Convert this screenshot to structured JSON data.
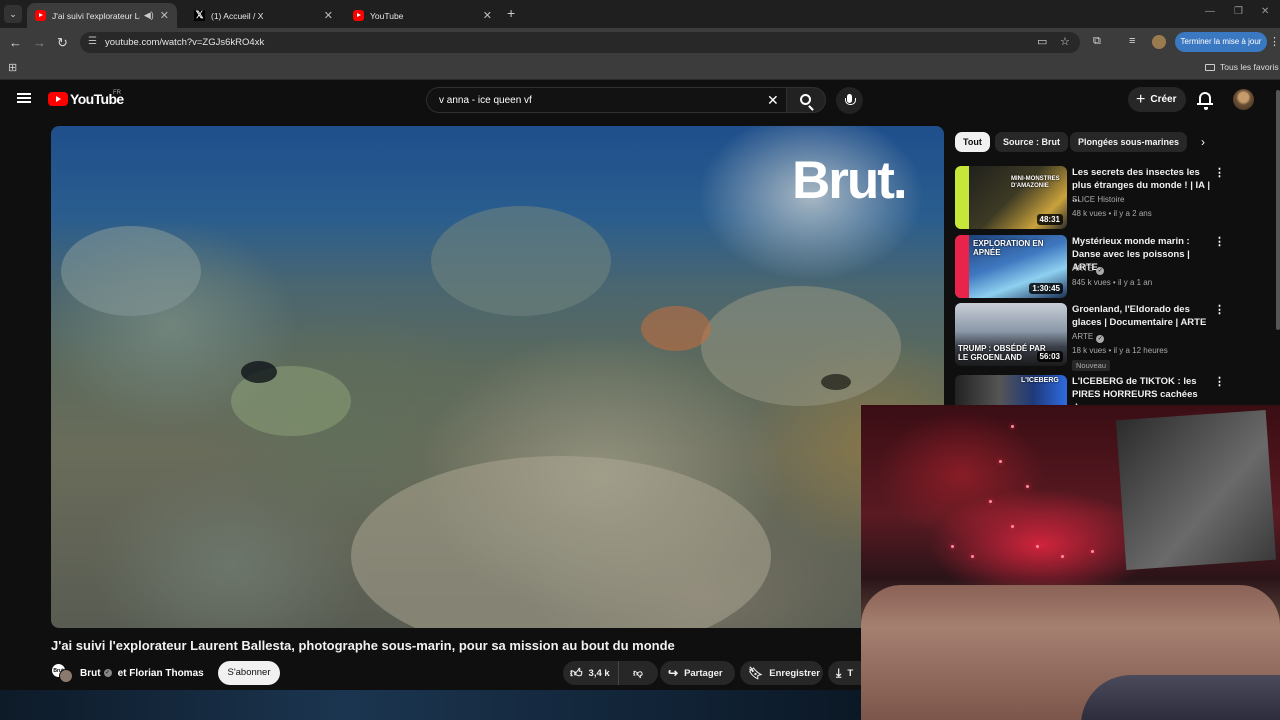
{
  "browser": {
    "tabs": [
      {
        "title": "J'ai suivi l'explorateur Laure",
        "active": true,
        "favicon": "youtube-icon"
      },
      {
        "title": "(1) Accueil / X",
        "active": false,
        "favicon": "x-icon"
      },
      {
        "title": "YouTube",
        "active": false,
        "favicon": "youtube-icon"
      }
    ],
    "url": "youtube.com/watch?v=ZGJs6kRO4xk",
    "update_button": "Terminer la mise à jour",
    "bookmarks_all": "Tous les favoris"
  },
  "youtube": {
    "logo_text": "YouTube",
    "country_code": "FR",
    "search_value": "v anna - ice queen vf",
    "create_label": "Créer",
    "brand_color": "#ff0000"
  },
  "video": {
    "watermark": "Brut.",
    "title": "J'ai suivi l'explorateur Laurent Ballesta, photographe sous-marin, pour sa mission au bout du monde",
    "channel": "Brut",
    "collab": "et Florian Thomas",
    "subscribe_label": "S'abonner",
    "likes": "3,4 k",
    "share_label": "Partager",
    "save_label": "Enregistrer",
    "download_label": "T"
  },
  "chips": [
    "Tout",
    "Source : Brut",
    "Plongées sous-marines"
  ],
  "recommendations": [
    {
      "title": "Les secrets des insectes les plus étranges du monde ! | IA | ...",
      "channel": "SLICE Histoire",
      "views": "48 k vues",
      "age": "il y a 2 ans",
      "duration": "48:31",
      "thumb_text": "MINI-MONSTRES D'AMAZONIE",
      "verified": false
    },
    {
      "title": "Mystérieux monde marin : Danse avec les poissons | ARTE",
      "channel": "ARTE",
      "views": "845 k vues",
      "age": "il y a 1 an",
      "duration": "1:30:45",
      "thumb_text": "EXPLORATION EN APNÉE",
      "verified": true
    },
    {
      "title": "Groenland, l'Eldorado des glaces | Documentaire | ARTE",
      "channel": "ARTE",
      "views": "18 k vues",
      "age": "il y a 12 heures",
      "duration": "56:03",
      "thumb_text": "TRUMP : OBSÉDÉ PAR LE GROENLAND",
      "badge": "Nouveau",
      "verified": true
    },
    {
      "title": "L'ICEBERG de TIKTOK : les PIRES HORREURS cachées de...",
      "thumb_text": "L'ICEBERG"
    }
  ]
}
